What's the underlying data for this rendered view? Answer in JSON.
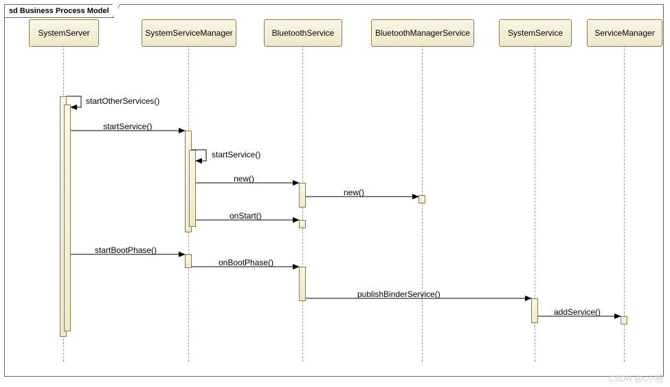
{
  "frame_title": "sd Business Process Model",
  "lifelines": {
    "l1": "SystemServer",
    "l2": "SystemServiceManager",
    "l3": "BluetoothService",
    "l4": "BluetoothManagerService",
    "l5": "SystemService",
    "l6": "ServiceManager"
  },
  "messages": {
    "m1": "startOtherServices()",
    "m2": "startService()",
    "m3": "startService()",
    "m4": "new()",
    "m5": "new()",
    "m6": "onStart()",
    "m7": "startBootPhase()",
    "m8": "onBootPhase()",
    "m9": "publishBinderService()",
    "m10": "addService()"
  },
  "watermark": "CSDN @c小旭",
  "chart_data": {
    "type": "uml-sequence-diagram",
    "frame": "sd Business Process Model",
    "lifelines": [
      "SystemServer",
      "SystemServiceManager",
      "BluetoothService",
      "BluetoothManagerService",
      "SystemService",
      "ServiceManager"
    ],
    "messages": [
      {
        "from": "SystemServer",
        "to": "SystemServer",
        "label": "startOtherServices()",
        "kind": "self"
      },
      {
        "from": "SystemServer",
        "to": "SystemServiceManager",
        "label": "startService()",
        "kind": "sync"
      },
      {
        "from": "SystemServiceManager",
        "to": "SystemServiceManager",
        "label": "startService()",
        "kind": "self"
      },
      {
        "from": "SystemServiceManager",
        "to": "BluetoothService",
        "label": "new()",
        "kind": "sync"
      },
      {
        "from": "BluetoothService",
        "to": "BluetoothManagerService",
        "label": "new()",
        "kind": "sync"
      },
      {
        "from": "SystemServiceManager",
        "to": "BluetoothService",
        "label": "onStart()",
        "kind": "sync"
      },
      {
        "from": "SystemServer",
        "to": "SystemServiceManager",
        "label": "startBootPhase()",
        "kind": "sync"
      },
      {
        "from": "SystemServiceManager",
        "to": "BluetoothService",
        "label": "onBootPhase()",
        "kind": "sync"
      },
      {
        "from": "BluetoothService",
        "to": "SystemService",
        "label": "publishBinderService()",
        "kind": "sync"
      },
      {
        "from": "SystemService",
        "to": "ServiceManager",
        "label": "addService()",
        "kind": "sync"
      }
    ]
  }
}
